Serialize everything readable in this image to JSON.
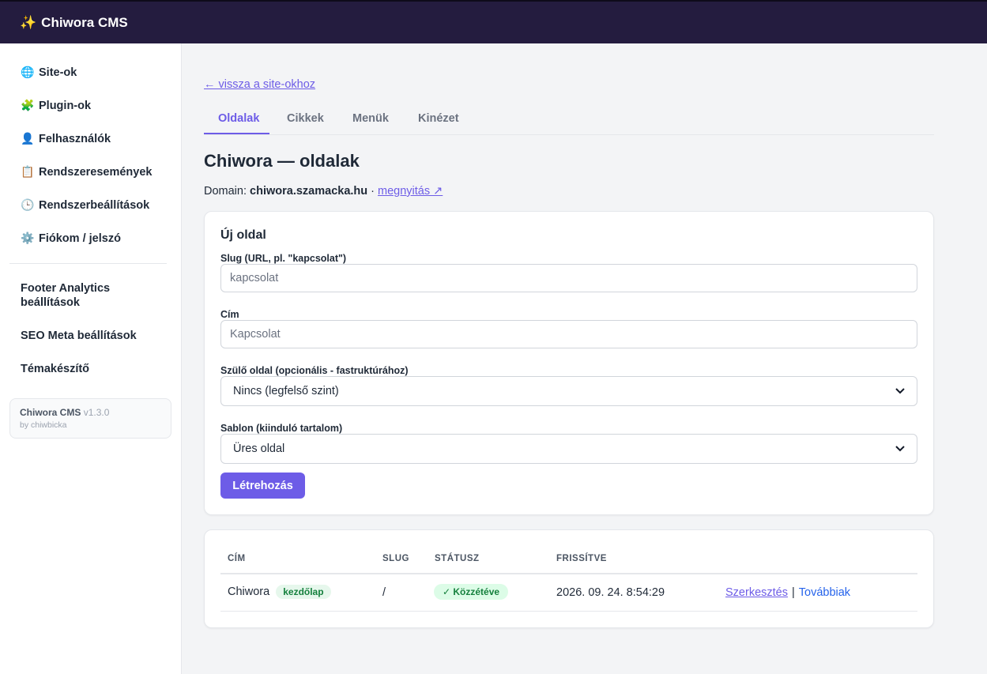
{
  "app": {
    "title": "Chiwora CMS"
  },
  "sidebar": {
    "items": [
      {
        "icon": "globe-icon",
        "label": "Site-ok"
      },
      {
        "icon": "puzzle-icon",
        "label": "Plugin-ok"
      },
      {
        "icon": "user-icon",
        "label": "Felhasználók"
      },
      {
        "icon": "clipboard-icon",
        "label": "Rendszeresemények"
      },
      {
        "icon": "clock-icon",
        "label": "Rendszerbeállítások"
      },
      {
        "icon": "gear-icon",
        "label": "Fiókom / jelszó"
      }
    ],
    "plugins": [
      {
        "label": "Footer Analytics beállítások"
      },
      {
        "label": "SEO Meta beállítások"
      },
      {
        "label": "Témakészítő"
      }
    ],
    "version": {
      "name": "Chiwora CMS",
      "number": "v1.3.0",
      "by": "by chiwbicka"
    }
  },
  "main": {
    "back_link": "← vissza a site-okhoz",
    "tabs": [
      {
        "label": "Oldalak",
        "active": true
      },
      {
        "label": "Cikkek",
        "active": false
      },
      {
        "label": "Menük",
        "active": false
      },
      {
        "label": "Kinézet",
        "active": false
      }
    ],
    "title": "Chiwora — oldalak",
    "domain_label": "Domain:",
    "domain": "chiwora.szamacka.hu",
    "domain_sep": "·",
    "open_link": "megnyitás ↗"
  },
  "form": {
    "title": "Új oldal",
    "slug_label": "Slug (URL, pl. \"kapcsolat\")",
    "slug_placeholder": "kapcsolat",
    "title_label": "Cím",
    "title_placeholder": "Kapcsolat",
    "parent_label": "Szülő oldal (opcionális - fastruktúrához)",
    "parent_value": "Nincs (legfelső szint)",
    "template_label": "Sablon (kiinduló tartalom)",
    "template_value": "Üres oldal",
    "submit_label": "Létrehozás"
  },
  "table": {
    "headers": [
      "CÍM",
      "SLUG",
      "STÁTUSZ",
      "FRISSÍTVE"
    ],
    "rows": [
      {
        "title": "Chiwora",
        "badge": "kezdőlap",
        "slug": "/",
        "status": "✓ Közzétéve",
        "updated": "2026. 09. 24. 8:54:29",
        "edit": "Szerkesztés",
        "sep": "|",
        "more": "Továbbiak"
      }
    ]
  },
  "colors": {
    "accent": "#6d5ce7",
    "topbar": "#241c3f",
    "success_bg": "#dcfce7",
    "success_text": "#15803d"
  }
}
